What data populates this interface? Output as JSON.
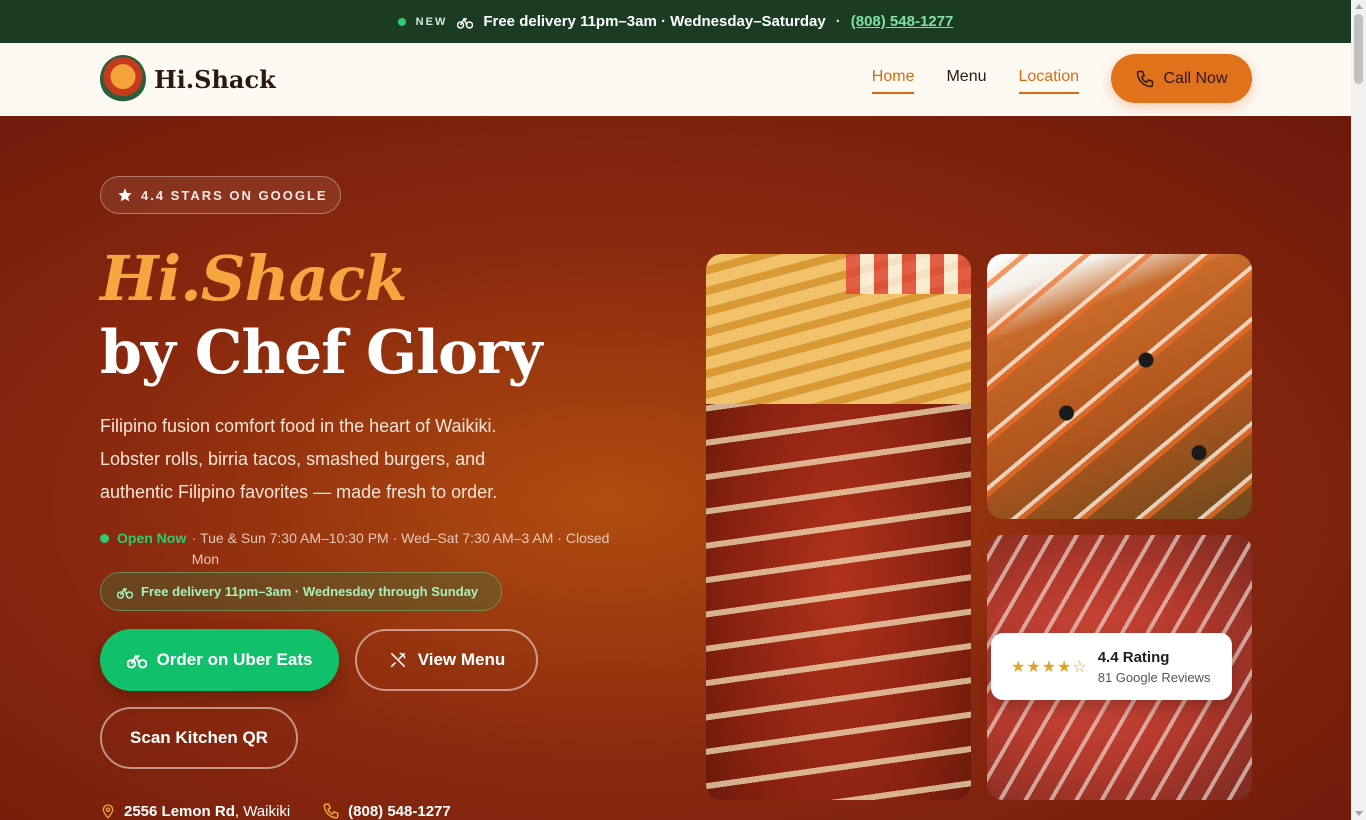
{
  "announcement": {
    "tag": "NEW",
    "text": "Free delivery 11pm–3am · Wednesday–Saturday",
    "separator": "·",
    "phone": "(808) 548-1277",
    "icons": [
      "status-dot",
      "bike-icon"
    ]
  },
  "nav": {
    "brand": "Hi.Shack",
    "links": [
      {
        "label": "Home",
        "active": true
      },
      {
        "label": "Menu",
        "active": false
      },
      {
        "label": "Location",
        "active": true
      }
    ],
    "call_label": "Call Now"
  },
  "hero": {
    "badge": "4.4 STARS ON GOOGLE",
    "title_line1": "Hi.Shack",
    "title_line2": "by Chef Glory",
    "description": "Filipino fusion comfort food in the heart of Waikiki. Lobster rolls, birria tacos, smashed burgers, and authentic Filipino favorites — made fresh to order.",
    "status": "Open Now",
    "hours": "· Tue & Sun 7:30 AM–10:30 PM · Wed–Sat 7:30 AM–3 AM · Closed Mon",
    "delivery_pill": "Free delivery 11pm–3am · Wednesday through Sunday",
    "buttons": {
      "uber": "Order on Uber Eats",
      "menu": "View Menu",
      "qr": "Scan Kitchen QR"
    },
    "contact": {
      "address_bold": "2556 Lemon Rd",
      "address_rest": ", Waikiki",
      "phone": "(808) 548-1277"
    }
  },
  "rating_card": {
    "stars": "★★★★☆",
    "score": "4.4 Rating",
    "count": "81 Google Reviews"
  },
  "colors": {
    "accent_orange": "#e2711b",
    "title_orange": "#f5a640",
    "announce_green": "#1b3b22",
    "uber_green": "#11c06b"
  }
}
